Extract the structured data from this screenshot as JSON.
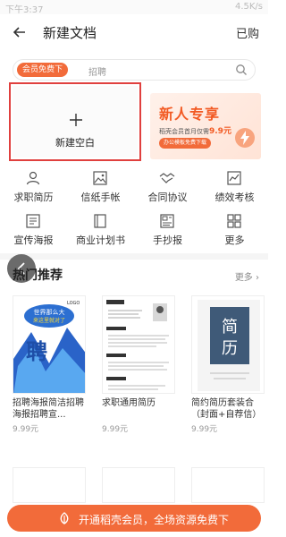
{
  "status_bar": {
    "time": "下午3:37",
    "right": "4.5K/s"
  },
  "header": {
    "title": "新建文档",
    "action_label": "已购"
  },
  "search": {
    "badge": "会员免费下",
    "placeholder": "招聘"
  },
  "new_blank": {
    "label": "新建空白"
  },
  "promo": {
    "title": "新人专享",
    "subtitle_prefix": "稻壳会员首月仅需",
    "price": "9.9元",
    "button": "办公模板免费下载"
  },
  "categories": [
    {
      "label": "求职简历",
      "icon": "user-icon"
    },
    {
      "label": "信纸手帐",
      "icon": "image-icon"
    },
    {
      "label": "合同协议",
      "icon": "handshake-icon"
    },
    {
      "label": "绩效考核",
      "icon": "chart-icon"
    },
    {
      "label": "宣传海报",
      "icon": "poster-icon"
    },
    {
      "label": "商业计划书",
      "icon": "book-icon"
    },
    {
      "label": "手抄报",
      "icon": "newspaper-icon"
    },
    {
      "label": "更多",
      "icon": "grid-icon"
    }
  ],
  "section": {
    "title": "热门推荐",
    "more": "更多"
  },
  "cards": [
    {
      "title": "招聘海报简洁招聘海报招聘宣...",
      "price": "9.99元",
      "thumb": {
        "poster_top": "世界那么大",
        "poster_mid": "来这里就对了",
        "poster_char": "聘",
        "logo": "LOGO"
      }
    },
    {
      "title": "求职通用简历",
      "price": "9.99元",
      "thumb": {}
    },
    {
      "title": "简约简历套装合（封面+自荐信）",
      "price": "9.99元",
      "thumb": {
        "char1": "简",
        "char2": "历"
      }
    }
  ],
  "bottom_cta": {
    "label": "开通稻壳会员，全场资源免费下"
  },
  "colors": {
    "accent": "#f26b3a",
    "highlight": "#e0403e"
  }
}
